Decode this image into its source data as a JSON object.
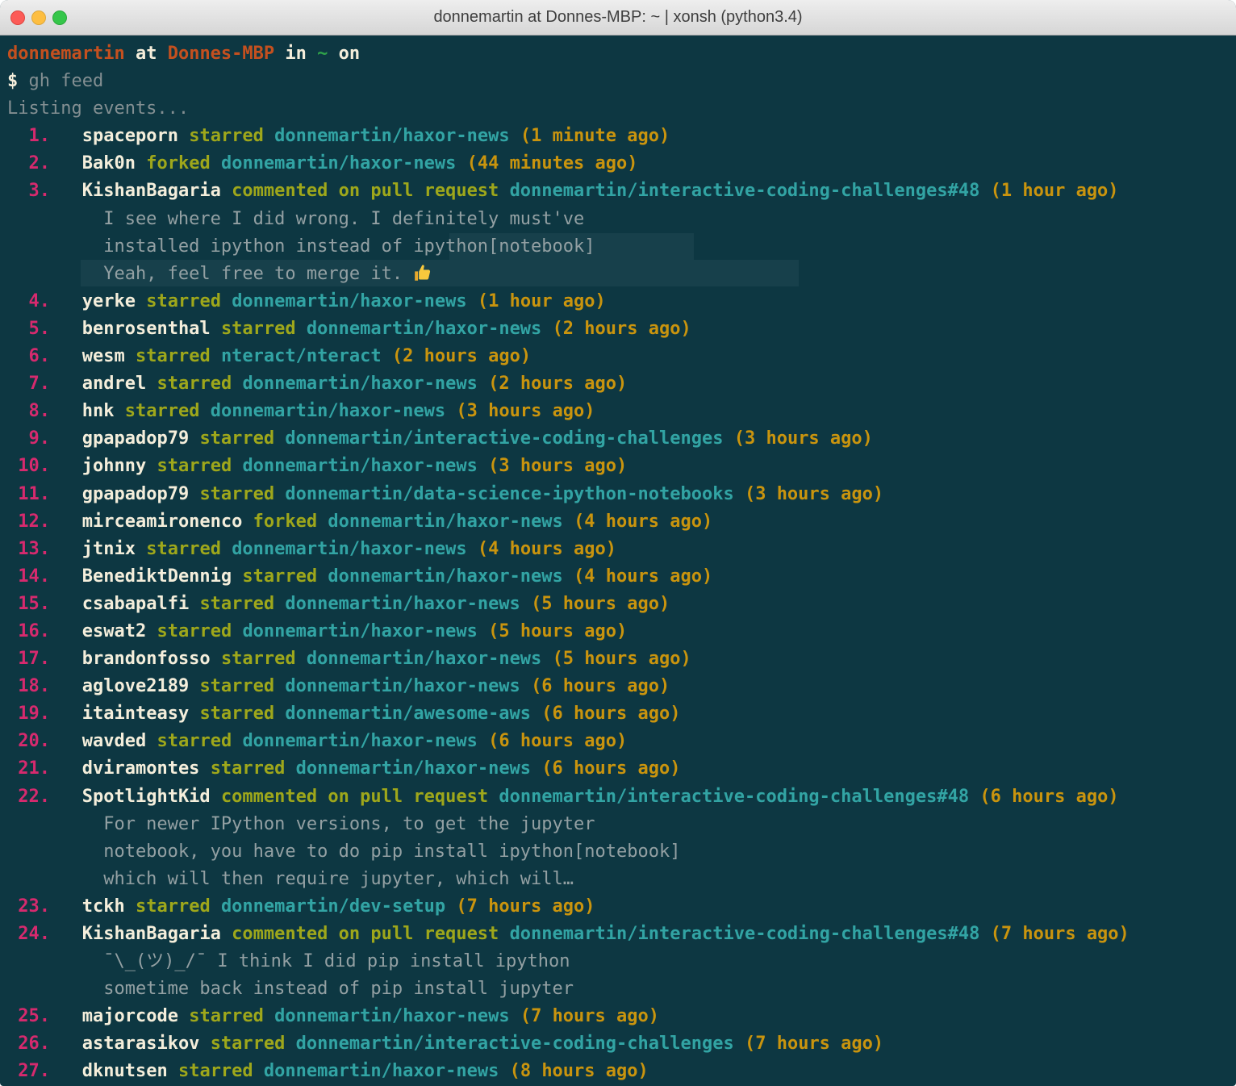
{
  "window": {
    "title": "donnemartin at Donnes-MBP: ~ | xonsh (python3.4)"
  },
  "colors": {
    "bg": "#0d3742",
    "orange": "#c4501f",
    "cream": "#f4eedb",
    "green": "#2fa24a",
    "pink": "#d62a6e",
    "olive": "#9ea71b",
    "teal": "#32a4a4",
    "gold": "#c9940e",
    "gray": "#93a0a3",
    "cmdgray": "#838f92"
  },
  "prompt": {
    "user": "donnemartin",
    "at": "at",
    "host": "Donnes-MBP",
    "in_word": "in",
    "path": "~",
    "on_word": "on"
  },
  "command": {
    "symbol": "$",
    "text": "gh feed"
  },
  "status": "Listing events...",
  "events": [
    {
      "num": 1,
      "user": "spaceporn",
      "action": "starred",
      "repo": "donnemartin/haxor-news",
      "time": "(1 minute ago)"
    },
    {
      "num": 2,
      "user": "Bak0n",
      "action": "forked",
      "repo": "donnemartin/haxor-news",
      "time": "(44 minutes ago)"
    },
    {
      "num": 3,
      "user": "KishanBagaria",
      "action": "commented on pull request",
      "repo": "donnemartin/interactive-coding-challenges#48",
      "time": "(1 hour ago)",
      "comment": [
        "I see where I did wrong. I definitely must've",
        "installed ipython instead of ipython[notebook]",
        "Yeah, feel free to merge it. "
      ],
      "comment_icon": "thumbs-up-emoji"
    },
    {
      "num": 4,
      "user": "yerke",
      "action": "starred",
      "repo": "donnemartin/haxor-news",
      "time": "(1 hour ago)"
    },
    {
      "num": 5,
      "user": "benrosenthal",
      "action": "starred",
      "repo": "donnemartin/haxor-news",
      "time": "(2 hours ago)"
    },
    {
      "num": 6,
      "user": "wesm",
      "action": "starred",
      "repo": "nteract/nteract",
      "time": "(2 hours ago)"
    },
    {
      "num": 7,
      "user": "andrel",
      "action": "starred",
      "repo": "donnemartin/haxor-news",
      "time": "(2 hours ago)"
    },
    {
      "num": 8,
      "user": "hnk",
      "action": "starred",
      "repo": "donnemartin/haxor-news",
      "time": "(3 hours ago)"
    },
    {
      "num": 9,
      "user": "gpapadop79",
      "action": "starred",
      "repo": "donnemartin/interactive-coding-challenges",
      "time": "(3 hours ago)"
    },
    {
      "num": 10,
      "user": "johnny",
      "action": "starred",
      "repo": "donnemartin/haxor-news",
      "time": "(3 hours ago)"
    },
    {
      "num": 11,
      "user": "gpapadop79",
      "action": "starred",
      "repo": "donnemartin/data-science-ipython-notebooks",
      "time": "(3 hours ago)"
    },
    {
      "num": 12,
      "user": "mirceamironenco",
      "action": "forked",
      "repo": "donnemartin/haxor-news",
      "time": "(4 hours ago)"
    },
    {
      "num": 13,
      "user": "jtnix",
      "action": "starred",
      "repo": "donnemartin/haxor-news",
      "time": "(4 hours ago)"
    },
    {
      "num": 14,
      "user": "BenediktDennig",
      "action": "starred",
      "repo": "donnemartin/haxor-news",
      "time": "(4 hours ago)"
    },
    {
      "num": 15,
      "user": "csabapalfi",
      "action": "starred",
      "repo": "donnemartin/haxor-news",
      "time": "(5 hours ago)"
    },
    {
      "num": 16,
      "user": "eswat2",
      "action": "starred",
      "repo": "donnemartin/haxor-news",
      "time": "(5 hours ago)"
    },
    {
      "num": 17,
      "user": "brandonfosso",
      "action": "starred",
      "repo": "donnemartin/haxor-news",
      "time": "(5 hours ago)"
    },
    {
      "num": 18,
      "user": "aglove2189",
      "action": "starred",
      "repo": "donnemartin/haxor-news",
      "time": "(6 hours ago)"
    },
    {
      "num": 19,
      "user": "itainteasy",
      "action": "starred",
      "repo": "donnemartin/awesome-aws",
      "time": "(6 hours ago)"
    },
    {
      "num": 20,
      "user": "wavded",
      "action": "starred",
      "repo": "donnemartin/haxor-news",
      "time": "(6 hours ago)"
    },
    {
      "num": 21,
      "user": "dviramontes",
      "action": "starred",
      "repo": "donnemartin/haxor-news",
      "time": "(6 hours ago)"
    },
    {
      "num": 22,
      "user": "SpotlightKid",
      "action": "commented on pull request",
      "repo": "donnemartin/interactive-coding-challenges#48",
      "time": "(6 hours ago)",
      "comment": [
        "For newer IPython versions, to get the jupyter",
        "notebook, you have to do pip install ipython[notebook]",
        "which will then require jupyter, which will…"
      ]
    },
    {
      "num": 23,
      "user": "tckh",
      "action": "starred",
      "repo": "donnemartin/dev-setup",
      "time": "(7 hours ago)"
    },
    {
      "num": 24,
      "user": "KishanBagaria",
      "action": "commented on pull request",
      "repo": "donnemartin/interactive-coding-challenges#48",
      "time": "(7 hours ago)",
      "comment": [
        "¯\\_(ツ)_/¯ I think I did pip install ipython",
        "sometime back instead of pip install jupyter"
      ]
    },
    {
      "num": 25,
      "user": "majorcode",
      "action": "starred",
      "repo": "donnemartin/haxor-news",
      "time": "(7 hours ago)"
    },
    {
      "num": 26,
      "user": "astarasikov",
      "action": "starred",
      "repo": "donnemartin/interactive-coding-challenges",
      "time": "(7 hours ago)"
    },
    {
      "num": 27,
      "user": "dknutsen",
      "action": "starred",
      "repo": "donnemartin/haxor-news",
      "time": "(8 hours ago)"
    }
  ]
}
